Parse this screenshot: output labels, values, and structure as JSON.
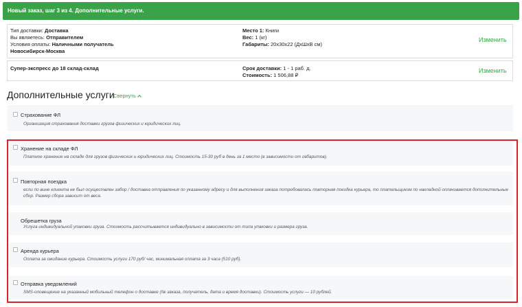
{
  "header": {
    "title": "Новый заказ, шаг 3 из 4. Дополнительные услуги."
  },
  "delivery_info": {
    "type_label": "Тип доставки:",
    "type_value": "Доставка",
    "role_label": "Вы являетесь:",
    "role_value": "Отправителем",
    "payment_label": "Условия оплаты:",
    "payment_value": "Наличными получатель",
    "route": "Новосибирск-Москва",
    "place_label": "Место 1:",
    "place_value": "Книги",
    "weight_label": "Вес:",
    "weight_value": "1 (кг)",
    "dims_label": "Габариты:",
    "dims_value": "20x30x22 (ДxШxВ см)",
    "change_label": "Изменить"
  },
  "tariff_info": {
    "name": "Супер-экспресс до 18 склад-склад",
    "term_label": "Срок доставки:",
    "term_value": "1 - 1 раб. д.",
    "cost_label": "Стоимость:",
    "cost_value": "1 506,88 ₽",
    "change_label": "Изменить"
  },
  "section": {
    "title": "Дополнительные услуги",
    "collapse_label": "Свернуть"
  },
  "services": [
    {
      "title": "Страхование ФЛ",
      "desc": [
        "Организация страхования доставки грузов физических и юридических лиц."
      ],
      "has_checkbox": true,
      "checked": false
    },
    {
      "title": "Хранение на складе ФЛ",
      "desc": [
        "Платное хранение на складе для грузов физических и юридических лиц. Стоимость 15-30 руб в день за 1 место (в зависимости от габаритов)."
      ],
      "has_checkbox": true,
      "checked": false
    },
    {
      "title": "Повторная поездка",
      "desc": [
        "если по вине клиента не был осуществлен забор / доставка отправления по указанному адресу и для выполнения заказа потребовалась повторная поездка курьера, то плательщиком по накладной оплачивается дополнительные",
        "сбор. Размер сбора зависит от веса."
      ],
      "has_checkbox": true,
      "checked": false
    },
    {
      "title": "Обрешетка груза",
      "desc": [
        "Услуга индивидуальной упаковки груза. Стоимость рассчитывается индивидуально в зависимости от типа упаковки и размера груза."
      ],
      "has_checkbox": false,
      "checked": false
    },
    {
      "title": "Аренда курьера",
      "desc": [
        "Оплата за ожидание курьера. Стоимость услуги 170 руб/ час, минимальная оплата за 3 часа (510 руб)."
      ],
      "has_checkbox": true,
      "checked": false
    },
    {
      "title": "Отправка уведомлений",
      "desc": [
        "SMS-оповещение на указанный мобильный телефон о доставке (№ заказа, получатель, дата и время доставки). Стоимость услуги — 10 рублей."
      ],
      "has_checkbox": true,
      "checked": false
    }
  ],
  "colors": {
    "accent": "#3aa34a",
    "highlight_frame": "#d9222a",
    "service_bg": "#f6f7f9"
  }
}
